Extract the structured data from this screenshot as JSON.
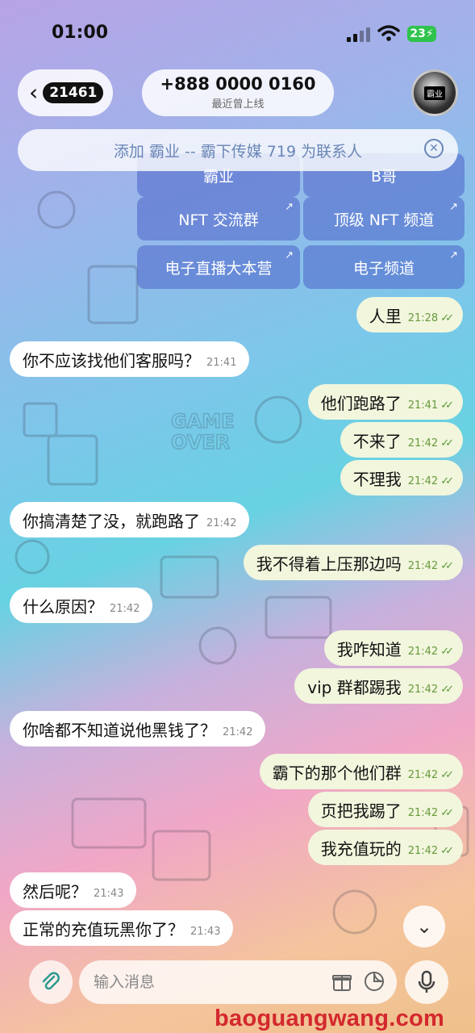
{
  "status": {
    "time": "01:00",
    "battery": "23"
  },
  "header": {
    "back_badge": "21461",
    "phone": "+888 0000 0160",
    "last_seen": "最近曾上线",
    "avatar_text": "霸业"
  },
  "banner": {
    "text": "添加 霸业 -- 霸下传媒 719 为联系人"
  },
  "keyboard": {
    "row0_left": "霸业",
    "row0_right": "B哥",
    "nft_group": "NFT 交流群",
    "nft_channel": "顶级 NFT 频道",
    "live_camp": "电子直播大本营",
    "e_channel": "电子频道"
  },
  "messages": [
    {
      "text": "人里",
      "time": "21:28",
      "dir": "out"
    },
    {
      "text": "你不应该找他们客服吗？",
      "time": "21:41",
      "dir": "in"
    },
    {
      "text": "他们跑路了",
      "time": "21:41",
      "dir": "out"
    },
    {
      "text": "不来了",
      "time": "21:42",
      "dir": "out"
    },
    {
      "text": "不理我",
      "time": "21:42",
      "dir": "out"
    },
    {
      "text": "你搞清楚了没，就跑路了",
      "time": "21:42",
      "dir": "in"
    },
    {
      "text": "我不得着上压那边吗",
      "time": "21:42",
      "dir": "out"
    },
    {
      "text": "什么原因？",
      "time": "21:42",
      "dir": "in"
    },
    {
      "text": "我咋知道",
      "time": "21:42",
      "dir": "out"
    },
    {
      "text": "vip 群都踢我",
      "time": "21:42",
      "dir": "out"
    },
    {
      "text": "你啥都不知道说他黑钱了？",
      "time": "21:42",
      "dir": "in"
    },
    {
      "text": "霸下的那个他们群",
      "time": "21:42",
      "dir": "out"
    },
    {
      "text": "页把我踢了",
      "time": "21:42",
      "dir": "out"
    },
    {
      "text": "我充值玩的",
      "time": "21:42",
      "dir": "out"
    },
    {
      "text": "然后呢？",
      "time": "21:43",
      "dir": "in"
    },
    {
      "text": "正常的充值玩黑你了？",
      "time": "21:43",
      "dir": "in"
    }
  ],
  "input": {
    "placeholder": "输入消息"
  },
  "watermark": "baoguangwang.com"
}
